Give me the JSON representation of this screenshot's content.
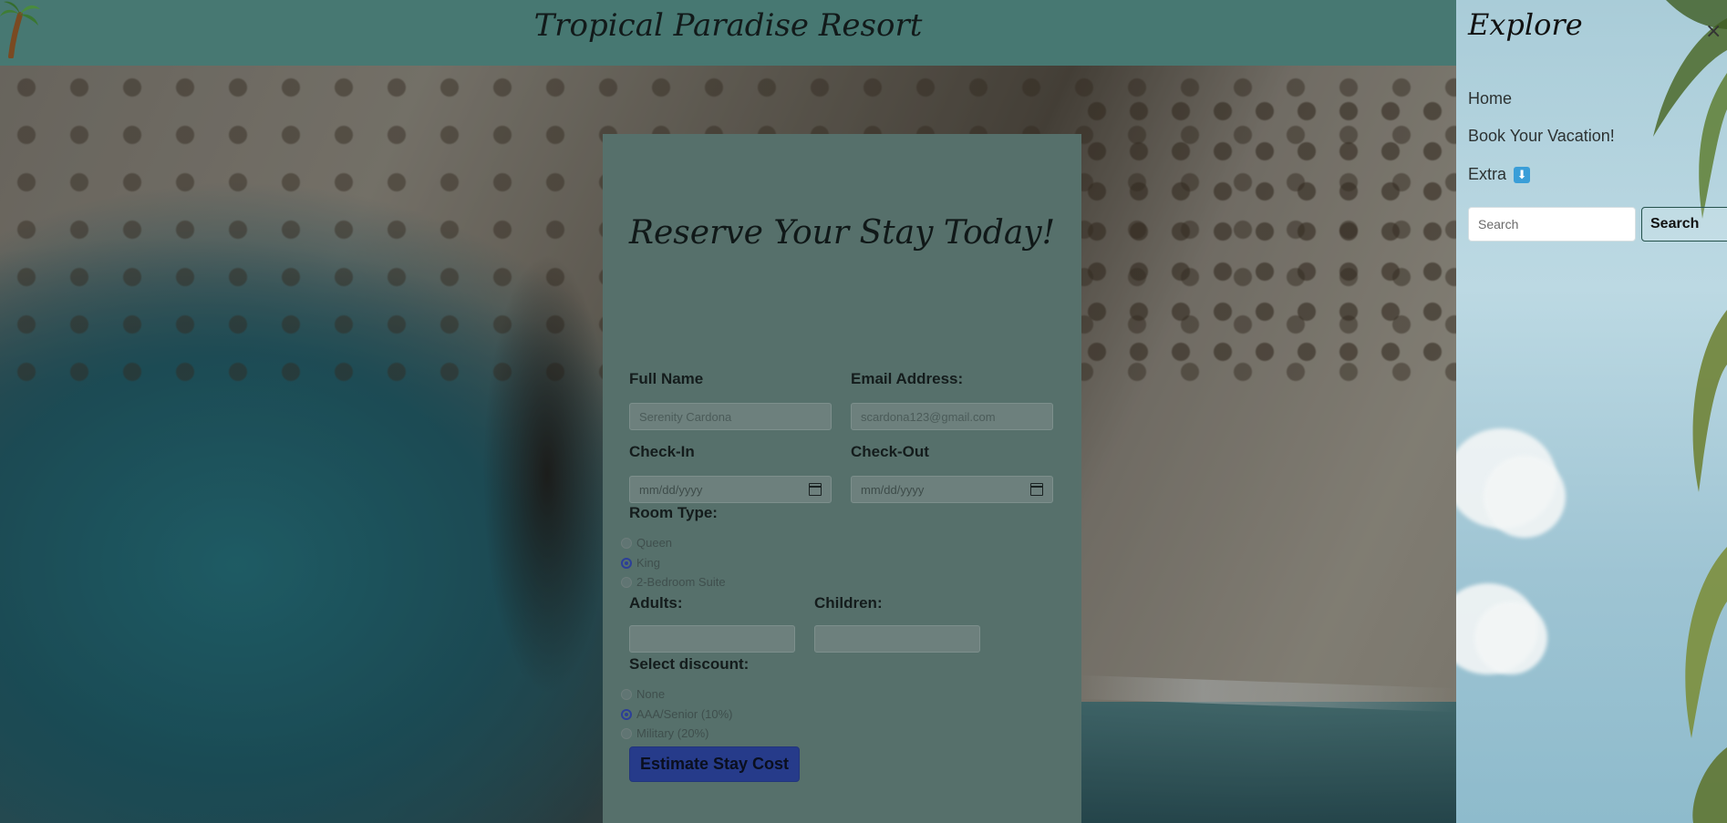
{
  "header": {
    "title": "Tropical Paradise Resort"
  },
  "form": {
    "heading": "Reserve Your Stay Today!",
    "full_name": {
      "label": "Full Name",
      "placeholder": "Serenity Cardona"
    },
    "email": {
      "label": "Email Address:",
      "placeholder": "scardona123@gmail.com"
    },
    "check_in": {
      "label": "Check-In",
      "value": "mm/dd/yyyy"
    },
    "check_out": {
      "label": "Check-Out",
      "value": "mm/dd/yyyy"
    },
    "room_type": {
      "label": "Room Type:",
      "options": [
        "Queen",
        "King",
        "2-Bedroom Suite"
      ],
      "selected": "King"
    },
    "adults": {
      "label": "Adults:"
    },
    "children": {
      "label": "Children:"
    },
    "discount": {
      "label": "Select discount:",
      "options": [
        "None",
        "AAA/Senior (10%)",
        "Military (20%)"
      ],
      "selected": "AAA/Senior (10%)"
    },
    "submit_label": "Estimate Stay Cost"
  },
  "sidebar": {
    "title": "Explore",
    "close_label": "×",
    "items": [
      {
        "label": "Home"
      },
      {
        "label": "Book Your Vacation!"
      },
      {
        "label": "Extra",
        "badge": "⬇"
      }
    ],
    "search_placeholder": "Search",
    "search_button": "Search"
  },
  "colors": {
    "header_bg": "#477872",
    "panel_bg": "#56706b",
    "button_bg": "#263b8a",
    "radio_selected": "#2c3f98"
  },
  "icons": [
    "palm-tree-icon",
    "calendar-icon",
    "close-icon",
    "down-arrow-icon"
  ]
}
